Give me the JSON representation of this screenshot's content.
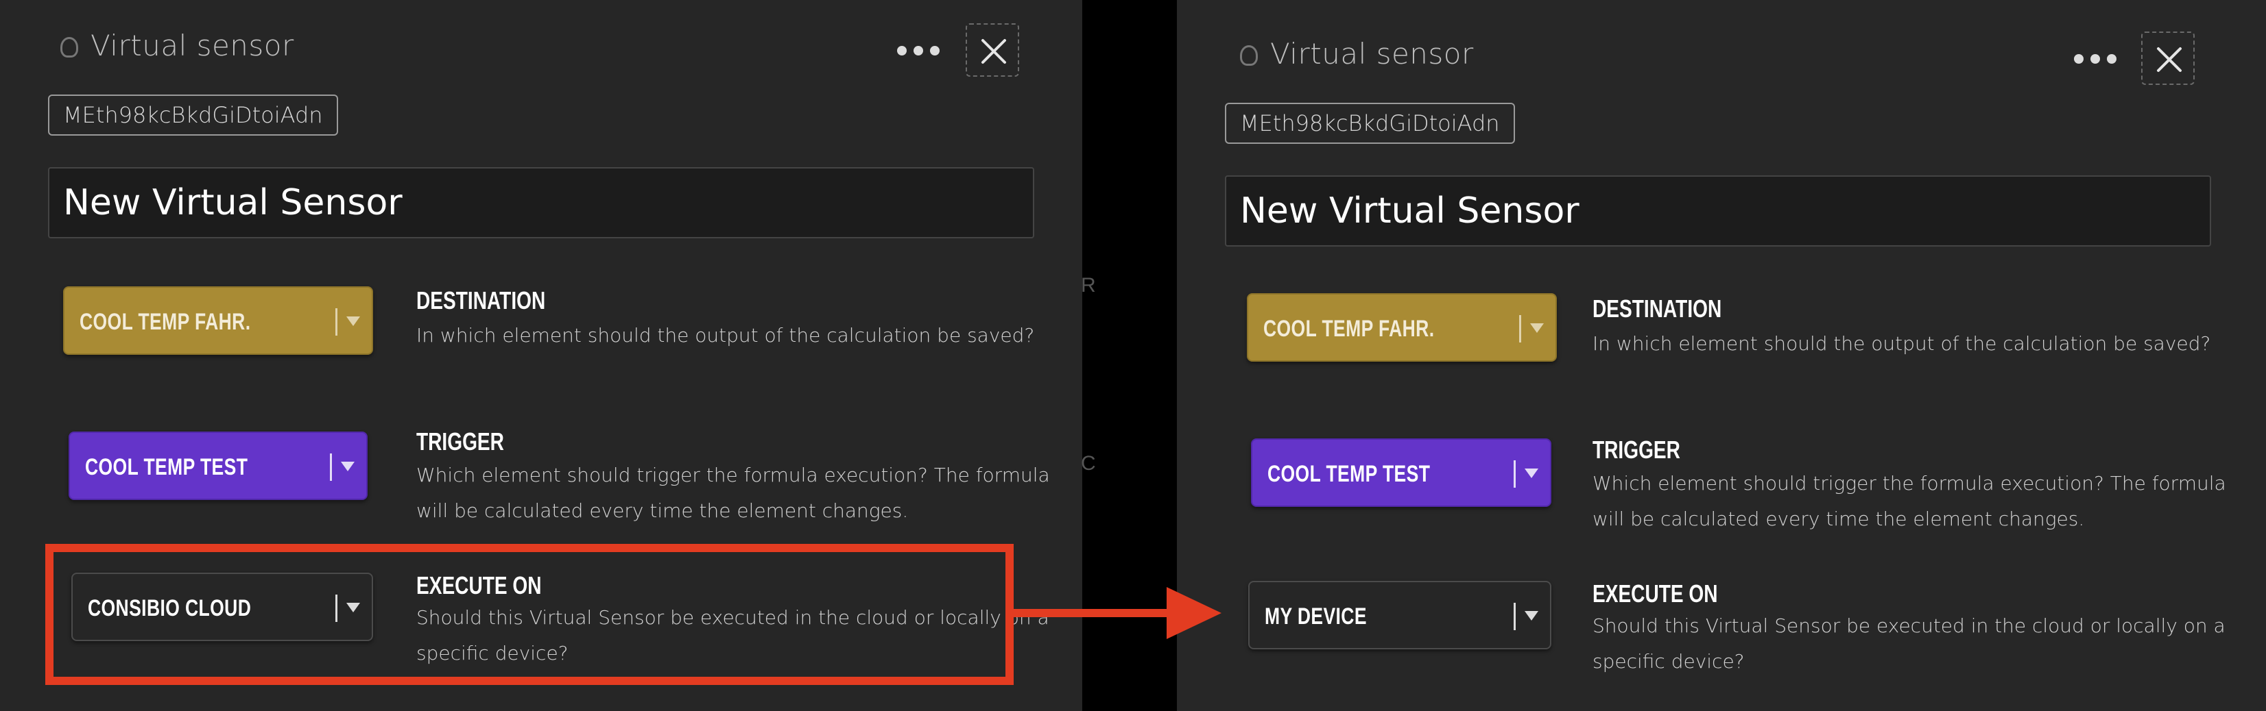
{
  "colors": {
    "background": "#262626",
    "gold": "#a98b34",
    "purple": "#6434c9",
    "highlight": "#e33c21"
  },
  "left_panel": {
    "title": "Virtual sensor",
    "id": "MEth98kcBkdGiDtoiAdn",
    "name": "New Virtual Sensor",
    "destination": {
      "value": "COOL TEMP FAHR.",
      "title": "DESTINATION",
      "description": "In which element should the output of the calculation be saved?"
    },
    "trigger": {
      "value": "COOL TEMP TEST",
      "title": "TRIGGER",
      "description_line1": "Which element should trigger the formula execution? The formula",
      "description_line2": "will be calculated every time the element changes."
    },
    "execute_on": {
      "value": "CONSIBIO CLOUD",
      "title": "EXECUTE ON",
      "description_line1": "Should this Virtual Sensor be executed in the cloud or locally on a",
      "description_line2": "specific device?"
    }
  },
  "right_panel": {
    "title": "Virtual sensor",
    "id": "MEth98kcBkdGiDtoiAdn",
    "name": "New Virtual Sensor",
    "destination": {
      "value": "COOL TEMP FAHR.",
      "title": "DESTINATION",
      "description": "In which element should the output of the calculation be saved?"
    },
    "trigger": {
      "value": "COOL TEMP TEST",
      "title": "TRIGGER",
      "description_line1": "Which element should trigger the formula execution? The formula",
      "description_line2": "will be calculated every time the element changes."
    },
    "execute_on": {
      "value": "MY DEVICE",
      "title": "EXECUTE ON",
      "description_line1": "Should this Virtual Sensor be executed in the cloud or locally on a",
      "description_line2": "specific device?"
    }
  },
  "background_fragment": {
    "char_a": "R",
    "char_b": "C"
  },
  "icons": [
    "sensor-icon",
    "more-icon",
    "close-icon",
    "caret-down-icon",
    "arrow-right-icon"
  ]
}
